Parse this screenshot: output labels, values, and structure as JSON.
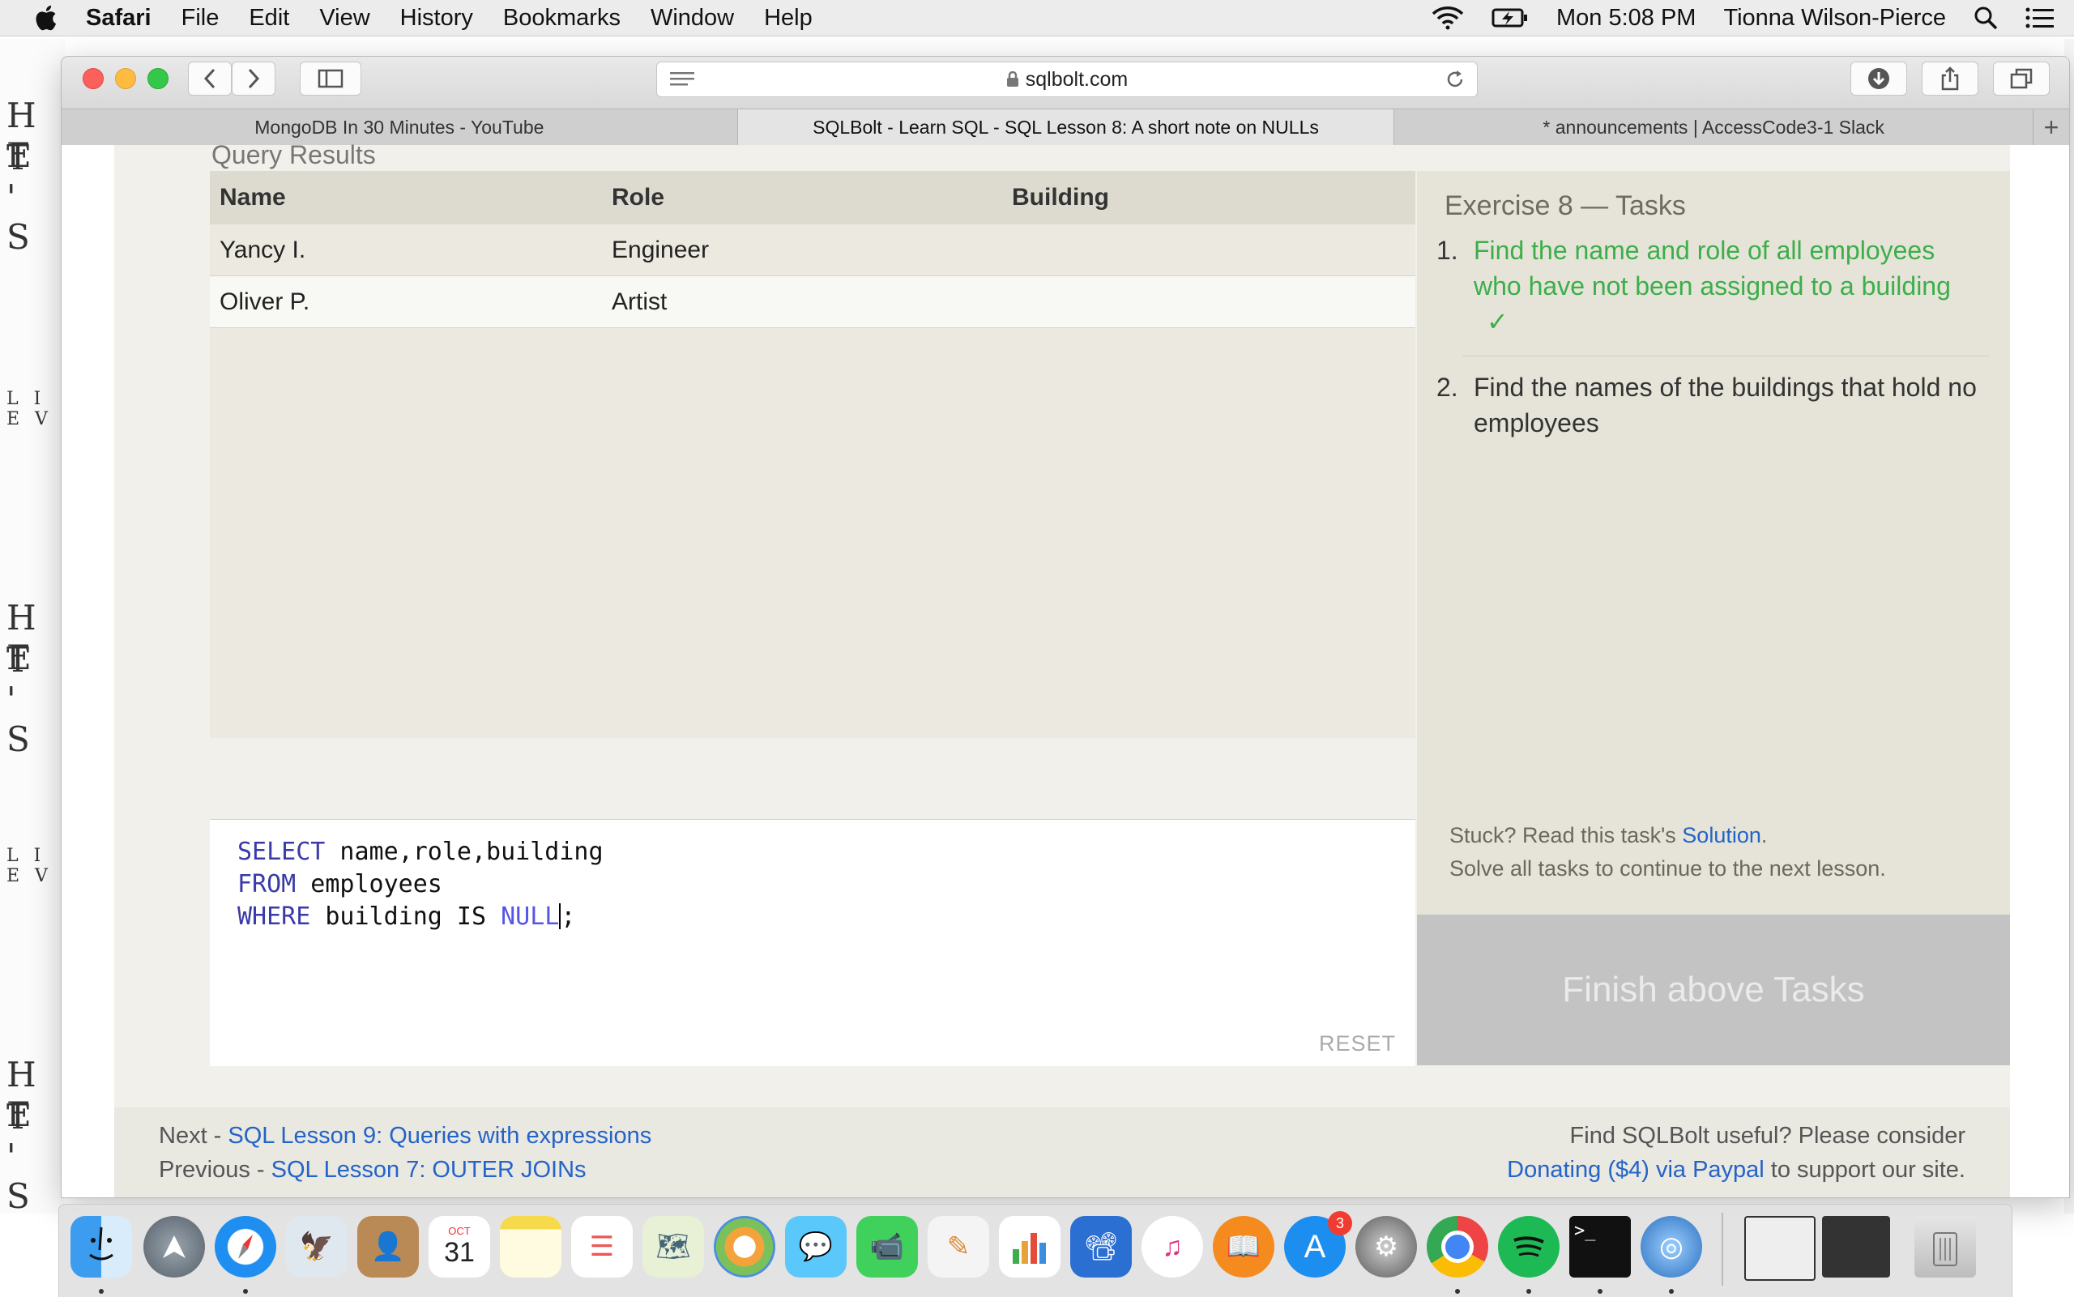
{
  "menubar": {
    "app": "Safari",
    "items": [
      "File",
      "Edit",
      "View",
      "History",
      "Bookmarks",
      "Window",
      "Help"
    ],
    "clock": "Mon 5:08 PM",
    "user": "Tionna Wilson-Pierce"
  },
  "wallpaper": {
    "line1": "H E",
    "line2": "T ' S",
    "line3": "L I E V"
  },
  "browser": {
    "address": "sqlbolt.com",
    "tabs": [
      {
        "title": "MongoDB In 30 Minutes - YouTube",
        "active": false
      },
      {
        "title": "SQLBolt - Learn SQL - SQL Lesson 8: A short note on NULLs",
        "active": true
      },
      {
        "title": "* announcements | AccessCode3-1 Slack",
        "active": false
      }
    ],
    "new_tab": "+"
  },
  "page": {
    "query_results_title": "Query Results",
    "columns": [
      "Name",
      "Role",
      "Building"
    ],
    "rows": [
      [
        "Yancy I.",
        "Engineer",
        ""
      ],
      [
        "Oliver P.",
        "Artist",
        ""
      ]
    ],
    "code": {
      "l1_kw": "SELECT",
      "l1_rest": " name,role,building",
      "l2_kw": "FROM",
      "l2_rest": " employees",
      "l3_kw": "WHERE",
      "l3_mid": " building IS ",
      "l3_null": "NULL",
      "l3_end": ";"
    },
    "reset_label": "RESET",
    "exercise_title": "Exercise 8 — Tasks",
    "tasks": [
      {
        "num": "1.",
        "text": "Find the name and role of all employees who have not been assigned to a building",
        "check": "✓",
        "done": true
      },
      {
        "num": "2.",
        "text": "Find the names of the buildings that hold no employees",
        "done": false
      }
    ],
    "stuck_prefix": "Stuck? Read this task's ",
    "solution_link": "Solution",
    "stuck_suffix": ".",
    "solve_all": "Solve all tasks to continue to the next lesson.",
    "finish_button": "Finish above Tasks",
    "footer": {
      "next_prefix": "Next - ",
      "next_link": "SQL Lesson 9: Queries with expressions",
      "prev_prefix": "Previous - ",
      "prev_link": "SQL Lesson 7: OUTER JOINs",
      "donate_text": "Find SQLBolt useful? Please consider",
      "donate_link": "Donating ($4) via Paypal",
      "donate_suffix": " to support our site."
    }
  },
  "dock": {
    "calendar_month": "OCT",
    "calendar_day": "31",
    "appstore_badge": "3",
    "terminal_prompt": ">_"
  },
  "colors": {
    "link": "#2463c8",
    "done_task": "#3cae4a",
    "keyword": "#3a3aa8",
    "finish_button_bg": "#c3c3c3"
  }
}
